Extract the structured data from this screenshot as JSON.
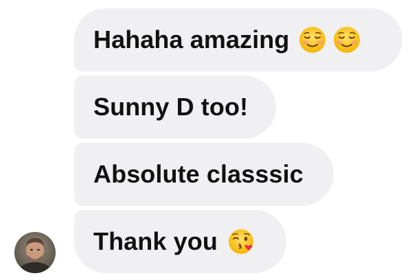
{
  "messages": [
    {
      "text": "Hahaha amazing",
      "emojis": [
        "smiling-face-icon",
        "smiling-face-icon"
      ]
    },
    {
      "text": "Sunny D too!",
      "emojis": []
    },
    {
      "text": "Absolute classsic",
      "emojis": []
    },
    {
      "text": "Thank you",
      "emojis": [
        "face-blowing-kiss-icon"
      ]
    }
  ],
  "avatar": {
    "icon": "user-avatar-photo"
  },
  "colors": {
    "bubble_bg": "#f0f0f2",
    "text": "#111111",
    "emoji_yellow": "#ffcc33",
    "kiss_heart": "#e8324a"
  }
}
